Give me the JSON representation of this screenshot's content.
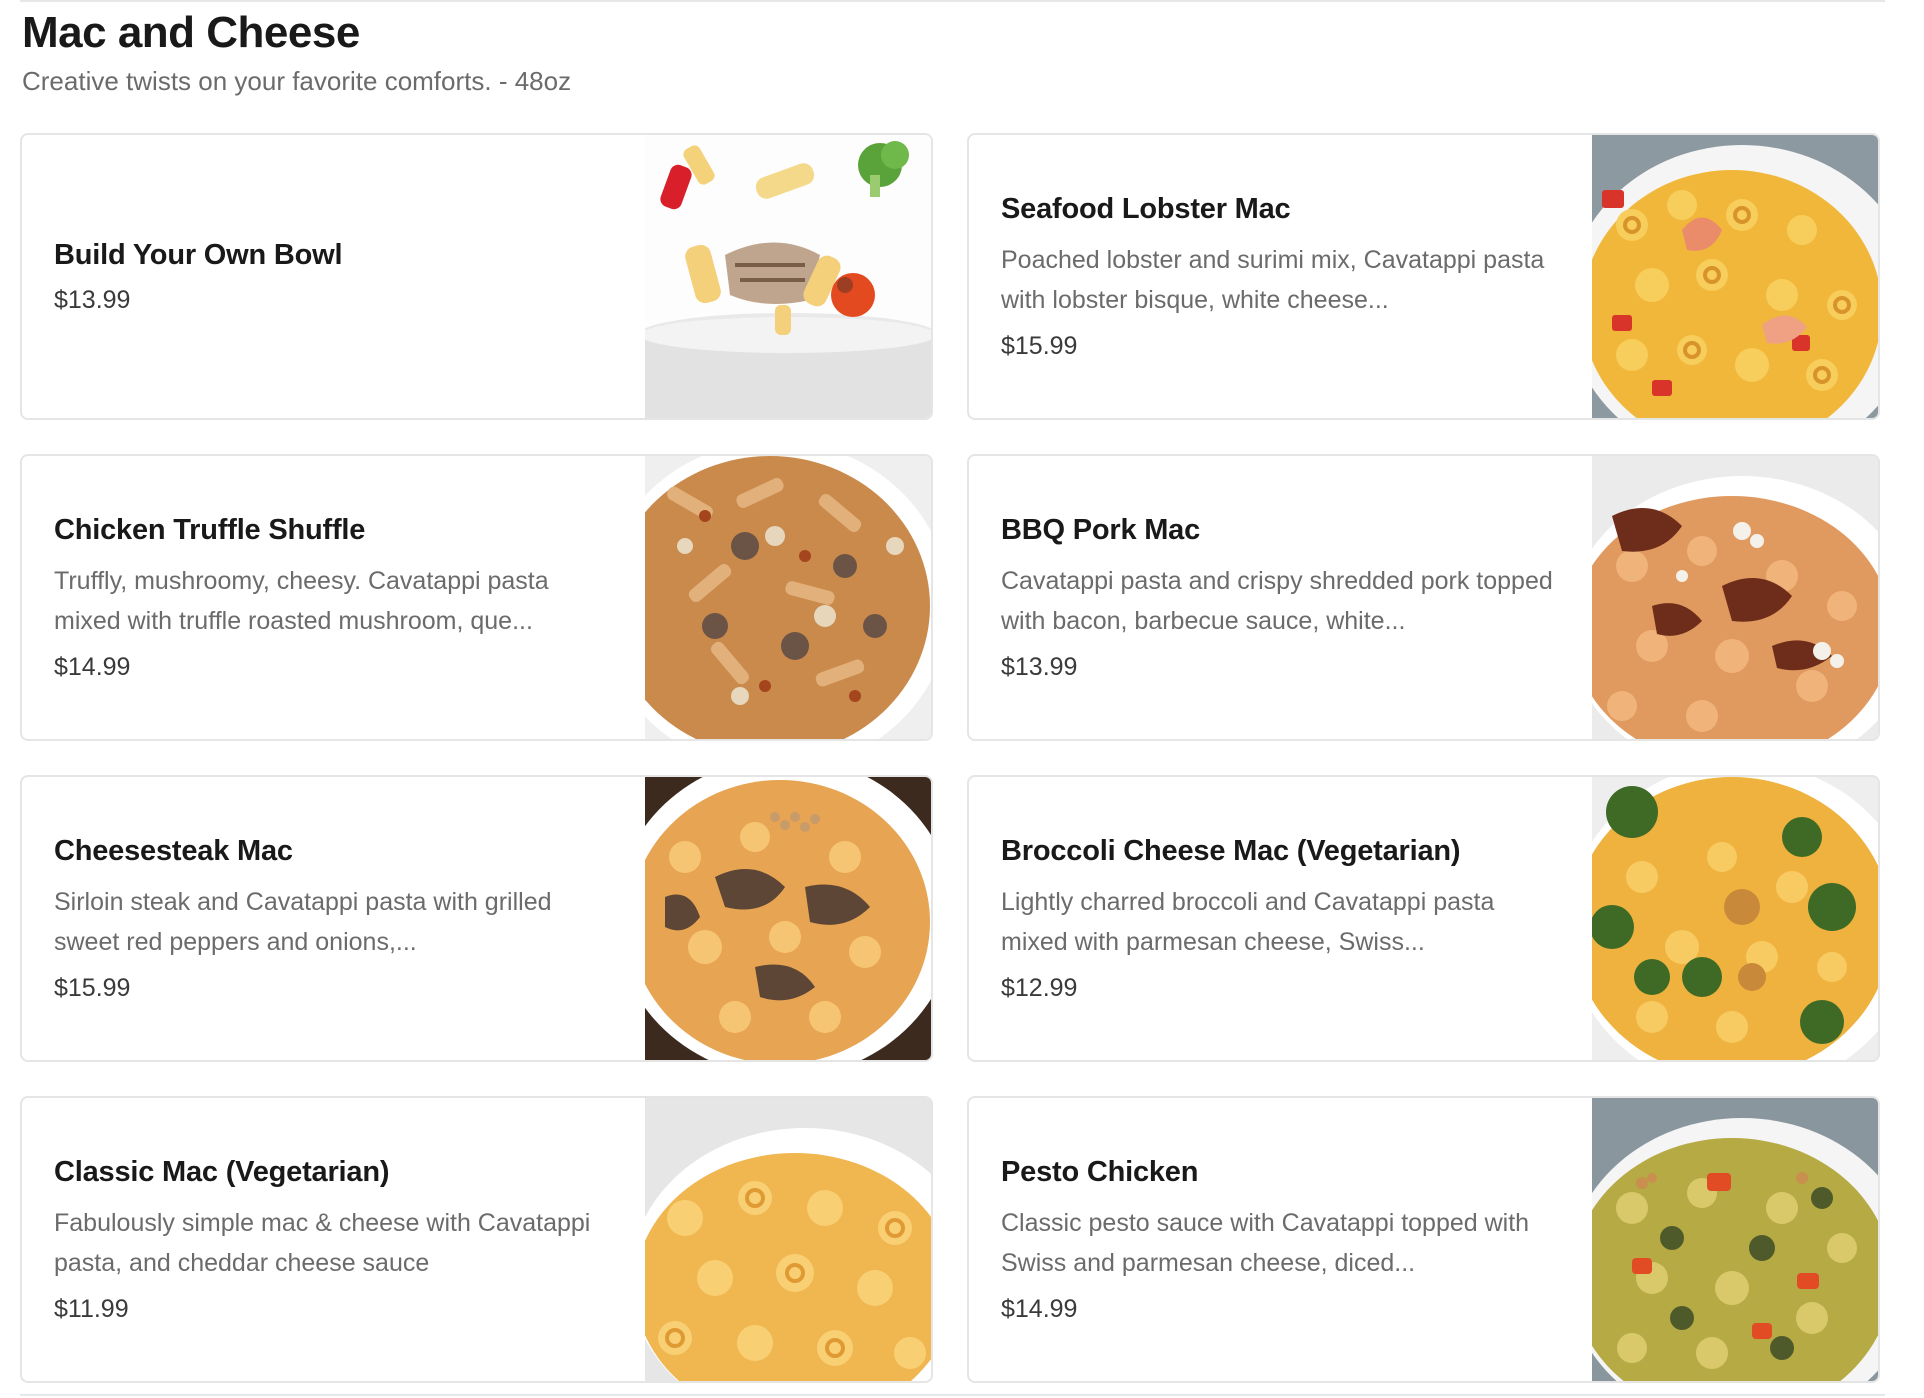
{
  "section": {
    "title": "Mac and Cheese",
    "subtitle": "Creative twists on your favorite comforts. - 48oz"
  },
  "items": [
    {
      "name": "Build Your Own Bowl",
      "description": "",
      "price": "$13.99",
      "image": "build-your-own-bowl-image"
    },
    {
      "name": "Seafood Lobster Mac",
      "description": "Poached lobster and surimi mix, Cavatappi pasta with lobster bisque, white cheese...",
      "price": "$15.99",
      "image": "seafood-lobster-mac-image"
    },
    {
      "name": "Chicken Truffle Shuffle",
      "description": "Truffly, mushroomy, cheesy. Cavatappi pasta mixed with truffle roasted mushroom, que...",
      "price": "$14.99",
      "image": "chicken-truffle-shuffle-image"
    },
    {
      "name": "BBQ Pork Mac",
      "description": "Cavatappi pasta and crispy shredded pork topped with bacon, barbecue sauce, white...",
      "price": "$13.99",
      "image": "bbq-pork-mac-image"
    },
    {
      "name": "Cheesesteak Mac",
      "description": "Sirloin steak and Cavatappi pasta with grilled sweet red peppers and onions,...",
      "price": "$15.99",
      "image": "cheesesteak-mac-image"
    },
    {
      "name": "Broccoli Cheese Mac (Vegetarian)",
      "description": "Lightly charred broccoli and Cavatappi pasta mixed with parmesan cheese, Swiss...",
      "price": "$12.99",
      "image": "broccoli-cheese-mac-image"
    },
    {
      "name": "Classic Mac (Vegetarian)",
      "description": "Fabulously simple mac & cheese with Cavatappi pasta, and cheddar cheese sauce",
      "price": "$11.99",
      "image": "classic-mac-image"
    },
    {
      "name": "Pesto Chicken",
      "description": "Classic pesto sauce with Cavatappi topped with Swiss and parmesan cheese, diced...",
      "price": "$14.99",
      "image": "pesto-chicken-image"
    }
  ],
  "colors": {
    "heading": "#191919",
    "muted_text": "#6b6b6b",
    "border": "#e5e5e5"
  }
}
